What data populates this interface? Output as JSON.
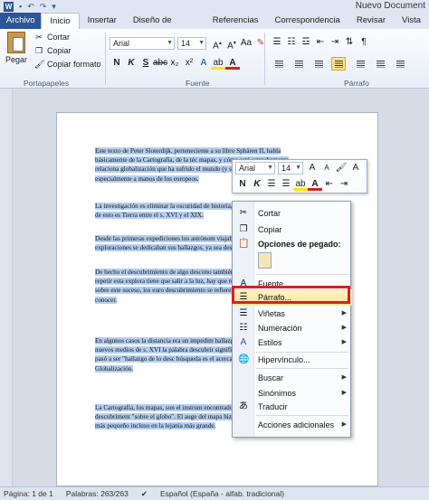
{
  "window": {
    "title": "Nuevo Document"
  },
  "tabs": [
    "Archivo",
    "Inicio",
    "Insertar",
    "Diseño de página",
    "Referencias",
    "Correspondencia",
    "Revisar",
    "Vista"
  ],
  "ribbon": {
    "paste_label": "Pegar",
    "cut_label": "Cortar",
    "copy_label": "Copiar",
    "format_painter_label": "Copiar formato",
    "font_name": "Arial",
    "font_size": "14",
    "groups": {
      "clipboard": "Portapapeles",
      "font": "Fuente",
      "paragraph": "Párrafo"
    },
    "bold": "N",
    "italic": "K",
    "underline": "S"
  },
  "document": {
    "paragraphs": [
      "Este texto de Peter Sloterdijk, perteneciente a su libro Sphären II, habla básicamente de la Cartografía, de la téc mapas, y cómo está estrechamente relaciona globalización que ha sufrido el mundo (y sobre largo de su historia, especialmente a manos de los europeos.",
      "La investigación es eliminar la oscuridad de historia, la mejor representación de esto es Tierra entre el s. XVI y el XIX.",
      "Desde las primeras expediciones los astrónom viajaban en estas exploraciones se dedicaban sus hallazgos, ya sea descubrimientos hechos.",
      "De hecho el descubrimiento de algo descono también los caminos para repetir esta explora tiene que salir a la luz, hay que retirar la osc anterioridad sobre este suceso, los euro descubrimiento se refieren al hecho y a lo que conocer.",
      "En algunos casos la distancia era un impedim hallazgos, pero aparecieron nuevos medios de s. XVI la palabra descubrir significaba qu objeto después pasó a ser \"hallazgo de lo desc búsqueda es el acercamiento, el des-alejam Globalización.",
      "La Cartografía, los mapas, son el instrum encontrado: la finalidad de un descubriment \"sobre el globo\". El auge del mapa hizo que llegara al detalle más pequeño incluso en la lejanía más grande."
    ]
  },
  "mini_toolbar": {
    "font_name": "Arial",
    "font_size": "14",
    "bold": "N",
    "italic": "K"
  },
  "context_menu": {
    "items": {
      "cut": "Cortar",
      "copy": "Copiar",
      "paste_options": "Opciones de pegado:",
      "font": "Fuente...",
      "paragraph": "Párrafo...",
      "bullets": "Viñetas",
      "numbering": "Numeración",
      "styles": "Estilos",
      "hyperlink": "Hipervínculo...",
      "search": "Buscar",
      "synonyms": "Sinónimos",
      "translate": "Traducir",
      "additional_actions": "Acciones adicionales"
    }
  },
  "status": {
    "page": "Página: 1 de 1",
    "words": "Palabras: 263/263",
    "language": "Español (España - alfab. tradicional)"
  },
  "colors": {
    "file_tab": "#2b579a",
    "selection": "#b5cff0",
    "highlight_border": "#e01b24"
  }
}
